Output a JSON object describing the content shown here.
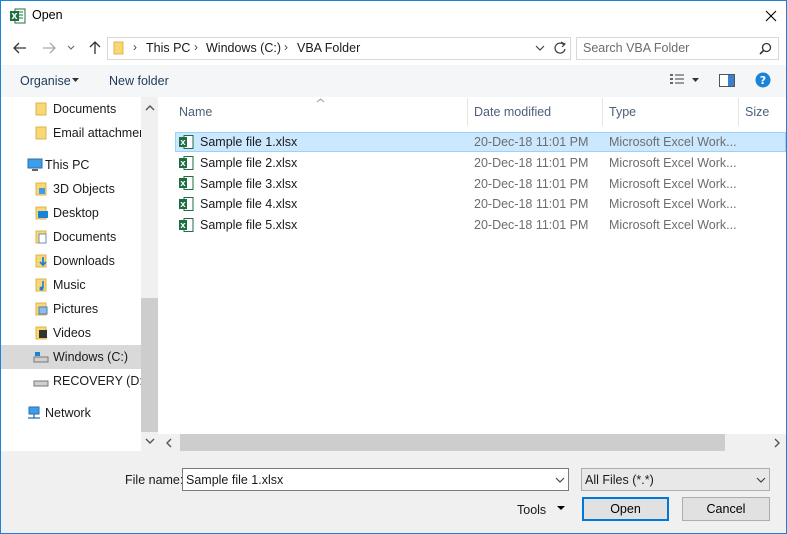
{
  "window": {
    "title": "Open"
  },
  "address": {
    "crumbs": [
      "This PC",
      "Windows (C:)",
      "VBA Folder"
    ],
    "search_placeholder": "Search VBA Folder"
  },
  "toolbar": {
    "organise": "Organise",
    "new_folder": "New folder"
  },
  "nav": {
    "items": [
      {
        "label": "Documents"
      },
      {
        "label": "Email attachmen"
      },
      {
        "label": "This PC"
      },
      {
        "label": "3D Objects"
      },
      {
        "label": "Desktop"
      },
      {
        "label": "Documents"
      },
      {
        "label": "Downloads"
      },
      {
        "label": "Music"
      },
      {
        "label": "Pictures"
      },
      {
        "label": "Videos"
      },
      {
        "label": "Windows (C:)"
      },
      {
        "label": "RECOVERY (D:)"
      },
      {
        "label": "Network"
      }
    ]
  },
  "columns": {
    "name": "Name",
    "date": "Date modified",
    "type": "Type",
    "size": "Size"
  },
  "files": [
    {
      "name": "Sample file 1.xlsx",
      "date": "20-Dec-18 11:01 PM",
      "type": "Microsoft Excel Work..."
    },
    {
      "name": "Sample file 2.xlsx",
      "date": "20-Dec-18 11:01 PM",
      "type": "Microsoft Excel Work..."
    },
    {
      "name": "Sample file 3.xlsx",
      "date": "20-Dec-18 11:01 PM",
      "type": "Microsoft Excel Work..."
    },
    {
      "name": "Sample file 4.xlsx",
      "date": "20-Dec-18 11:01 PM",
      "type": "Microsoft Excel Work..."
    },
    {
      "name": "Sample file 5.xlsx",
      "date": "20-Dec-18 11:01 PM",
      "type": "Microsoft Excel Work..."
    }
  ],
  "bottom": {
    "file_name_label": "File name:",
    "file_name_value": "Sample file 1.xlsx",
    "filter_value": "All Files (*.*)",
    "tools": "Tools",
    "open": "Open",
    "cancel": "Cancel"
  },
  "colors": {
    "accent": "#0078d7",
    "selection": "#cce8ff",
    "excel_green": "#1d6f42"
  }
}
